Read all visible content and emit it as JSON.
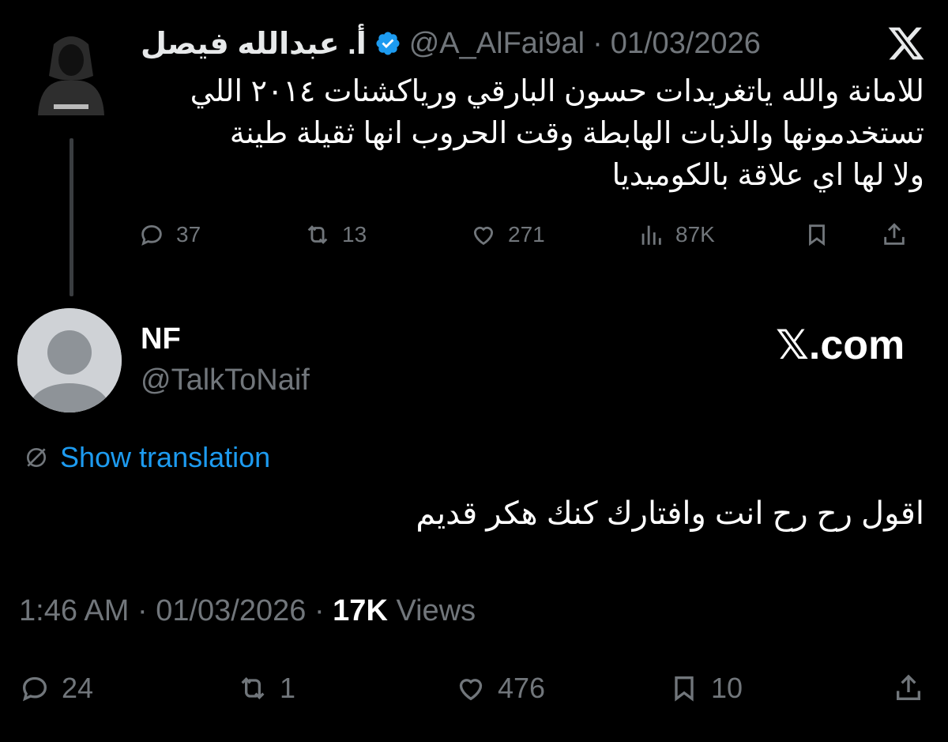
{
  "parent": {
    "author_name": "أ. عبدالله فيصل",
    "handle": "@A_AlFai9al",
    "separator": "·",
    "date": "01/03/2026",
    "text_lines": [
      "للامانة والله ياتغريدات حسون البارقي ورياكشنات ٢٠١٤ اللي",
      "تستخدمونها والذبات الهابطة وقت الحروب انها ثقيلة طينة",
      "ولا لها اي علاقة بالكوميديا"
    ],
    "actions": {
      "replies": "37",
      "reposts": "13",
      "likes": "271",
      "views": "87K"
    }
  },
  "reply": {
    "author_name": "NF",
    "handle": "@TalkToNaif",
    "show_translation": "Show translation",
    "text": "اقول رح رح انت وافتارك كنك هكر قديم",
    "time": "1:46 AM",
    "sep1": "·",
    "date": "01/03/2026",
    "sep2": "·",
    "views_count": "17K",
    "views_label": "Views",
    "actions": {
      "replies": "24",
      "reposts": "1",
      "likes": "476",
      "bookmarks": "10"
    }
  },
  "branding": {
    "site": "𝕏.com"
  },
  "colors": {
    "background": "#000000",
    "text": "#e7e9ea",
    "muted": "#71767b",
    "link": "#1d9bf0",
    "verified": "#1d9bf0"
  }
}
